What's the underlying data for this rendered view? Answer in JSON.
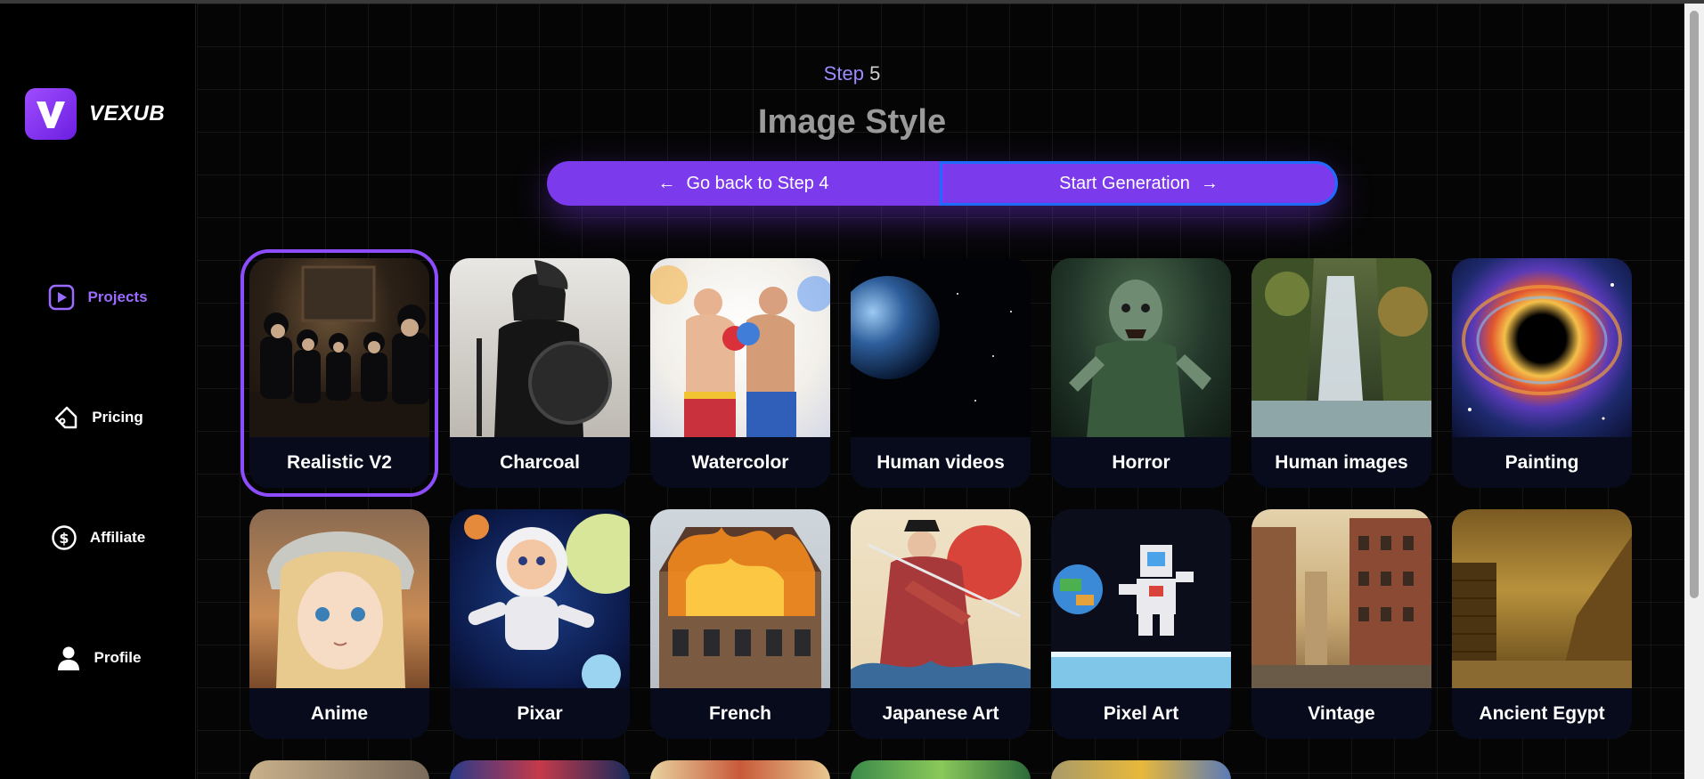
{
  "brand": {
    "name": "VEXUB"
  },
  "nav": [
    {
      "label": "Projects",
      "icon": "play-icon",
      "active": true
    },
    {
      "label": "Pricing",
      "icon": "tag-icon",
      "active": false
    },
    {
      "label": "Affiliate",
      "icon": "dollar-icon",
      "active": false
    },
    {
      "label": "Profile",
      "icon": "user-icon",
      "active": false
    }
  ],
  "header": {
    "step_word": "Step",
    "step_number": "5",
    "title": "Image Style"
  },
  "buttons": {
    "back_label": "Go back to Step 4",
    "start_label": "Start Generation"
  },
  "styles": [
    {
      "label": "Realistic V2",
      "selected": true
    },
    {
      "label": "Charcoal",
      "selected": false
    },
    {
      "label": "Watercolor",
      "selected": false
    },
    {
      "label": "Human videos",
      "selected": false
    },
    {
      "label": "Horror",
      "selected": false
    },
    {
      "label": "Human images",
      "selected": false
    },
    {
      "label": "Painting",
      "selected": false
    },
    {
      "label": "Anime",
      "selected": false
    },
    {
      "label": "Pixar",
      "selected": false
    },
    {
      "label": "French",
      "selected": false
    },
    {
      "label": "Japanese Art",
      "selected": false
    },
    {
      "label": "Pixel Art",
      "selected": false
    },
    {
      "label": "Vintage",
      "selected": false
    },
    {
      "label": "Ancient Egypt",
      "selected": false
    }
  ],
  "colors": {
    "accent": "#7c3aed",
    "selected_outline": "#8d4dff",
    "focus_ring": "#1e6bff"
  }
}
